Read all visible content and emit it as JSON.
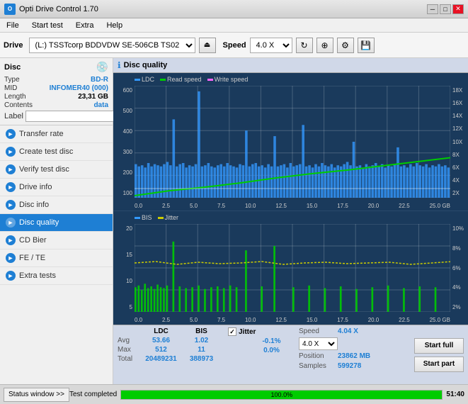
{
  "titlebar": {
    "app_name": "Opti Drive Control 1.70",
    "icon_text": "O"
  },
  "menu": {
    "items": [
      "File",
      "Start test",
      "Extra",
      "Help"
    ]
  },
  "toolbar": {
    "drive_label": "Drive",
    "drive_value": "(L:)  TSSTcorp BDDVDW SE-506CB TS02",
    "speed_label": "Speed",
    "speed_value": "4.0 X"
  },
  "disc_section": {
    "title": "Disc",
    "type_label": "Type",
    "type_value": "BD-R",
    "mid_label": "MID",
    "mid_value": "INFOMER40 (000)",
    "length_label": "Length",
    "length_value": "23,31 GB",
    "contents_label": "Contents",
    "contents_value": "data",
    "label_label": "Label"
  },
  "sidebar_items": [
    {
      "id": "transfer-rate",
      "label": "Transfer rate",
      "icon": "►"
    },
    {
      "id": "create-test-disc",
      "label": "Create test disc",
      "icon": "►"
    },
    {
      "id": "verify-test-disc",
      "label": "Verify test disc",
      "icon": "►"
    },
    {
      "id": "drive-info",
      "label": "Drive info",
      "icon": "►"
    },
    {
      "id": "disc-info",
      "label": "Disc info",
      "icon": "►"
    },
    {
      "id": "disc-quality",
      "label": "Disc quality",
      "icon": "►",
      "active": true
    },
    {
      "id": "cd-bier",
      "label": "CD Bier",
      "icon": "►"
    },
    {
      "id": "fe-te",
      "label": "FE / TE",
      "icon": "►"
    },
    {
      "id": "extra-tests",
      "label": "Extra tests",
      "icon": "►"
    }
  ],
  "disc_quality": {
    "title": "Disc quality",
    "legend": {
      "ldc_label": "LDC",
      "ldc_color": "#3399ff",
      "read_speed_label": "Read speed",
      "read_speed_color": "#00cc00",
      "write_speed_label": "Write speed",
      "write_speed_color": "#ff66ff"
    },
    "chart_top": {
      "y_labels_left": [
        "600",
        "500",
        "400",
        "300",
        "200",
        "100"
      ],
      "y_labels_right": [
        "18X",
        "16X",
        "14X",
        "12X",
        "10X",
        "8X",
        "6X",
        "4X",
        "2X"
      ],
      "x_labels": [
        "0.0",
        "2.5",
        "5.0",
        "7.5",
        "10.0",
        "12.5",
        "15.0",
        "17.5",
        "20.0",
        "22.5",
        "25.0 GB"
      ]
    },
    "chart_bottom": {
      "legend_bis": "BIS",
      "legend_jitter": "Jitter",
      "bis_color": "#00cc00",
      "jitter_color": "#ffff00",
      "y_labels_left": [
        "20",
        "15",
        "10",
        "5"
      ],
      "y_labels_right": [
        "10%",
        "8%",
        "6%",
        "4%",
        "2%"
      ],
      "x_labels": [
        "0.0",
        "2.5",
        "5.0",
        "7.5",
        "10.0",
        "12.5",
        "15.0",
        "17.5",
        "20.0",
        "22.5",
        "25.0 GB"
      ]
    }
  },
  "stats": {
    "col_ldc": "LDC",
    "col_bis": "BIS",
    "col_jitter": "Jitter",
    "row_avg": "Avg",
    "row_max": "Max",
    "row_total": "Total",
    "avg_ldc": "53.66",
    "avg_bis": "1.02",
    "avg_jitter": "-0.1%",
    "max_ldc": "512",
    "max_bis": "11",
    "max_jitter": "0.0%",
    "total_ldc": "20489231",
    "total_bis": "388973",
    "speed_label": "Speed",
    "speed_value": "4.04 X",
    "speed_select": "4.0 X",
    "position_label": "Position",
    "position_value": "23862 MB",
    "samples_label": "Samples",
    "samples_value": "599278",
    "btn_start_full": "Start full",
    "btn_start_part": "Start part"
  },
  "statusbar": {
    "status_window_label": "Status window >>",
    "test_completed": "Test completed",
    "progress_pct": "100.0%",
    "time": "51:40"
  },
  "colors": {
    "accent_blue": "#1e7fd4",
    "chart_bg": "#1a3a5c",
    "ldc_bar": "#3399ff",
    "read_speed": "#00cc00",
    "write_speed": "#ff66ff",
    "bis_bar": "#00cc00",
    "jitter_bar": "#ffff00"
  }
}
